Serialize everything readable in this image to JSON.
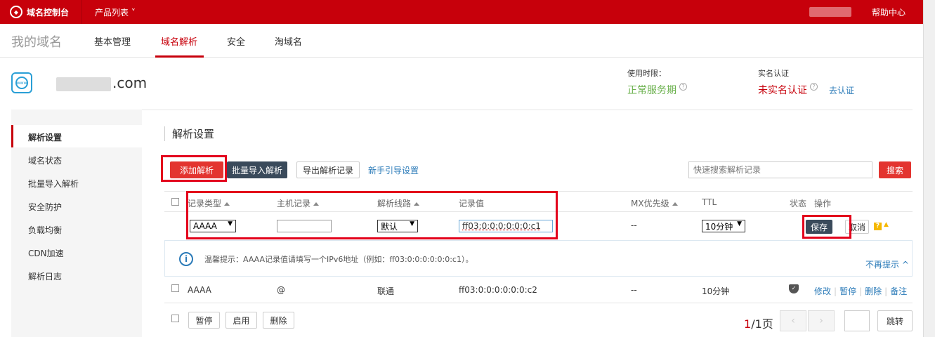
{
  "topbar": {
    "console_label": "域名控制台",
    "products_label": "产品列表 ˅",
    "help_label": "帮助中心"
  },
  "subnav": {
    "brand": "我的域名",
    "tabs": [
      "基本管理",
      "域名解析",
      "安全",
      "淘域名"
    ],
    "active_tab": "域名解析"
  },
  "domain": {
    "name_suffix": ".com",
    "period_label": "使用时限：",
    "period_value": "正常服务期",
    "realname_label": "实名认证",
    "realname_value": "未实名认证",
    "verify_link": "去认证"
  },
  "sidebar": {
    "items": [
      "解析设置",
      "域名状态",
      "批量导入解析",
      "安全防护",
      "负载均衡",
      "CDN加速",
      "解析日志"
    ],
    "active": "解析设置"
  },
  "content": {
    "section_title": "解析设置",
    "toolbar": {
      "add_label": "添加解析",
      "batch_import_label": "批量导入解析",
      "export_label": "导出解析记录",
      "guide_link": "新手引导设置",
      "search_placeholder": "快速搜索解析记录",
      "search_button": "搜索"
    },
    "columns": [
      "记录类型",
      "主机记录",
      "解析线路",
      "记录值",
      "MX优先级",
      "TTL",
      "状态",
      "操作"
    ],
    "edit_row": {
      "type": "AAAA",
      "host": "",
      "line": "默认",
      "value": "ff03:0:0:0:0:0:0:c1",
      "mx": "--",
      "ttl": "10分钟",
      "save_label": "保存",
      "cancel_label": "取消"
    },
    "tip": {
      "text": "温馨提示：AAAA记录值请填写一个IPv6地址（例如：ff03:0:0:0:0:0:0:c1）。",
      "dismiss": "不再提示"
    },
    "records": [
      {
        "type": "AAAA",
        "host": "@",
        "line": "联通",
        "value": "ff03:0:0:0:0:0:0:c2",
        "mx": "--",
        "ttl": "10分钟",
        "actions": [
          "修改",
          "暂停",
          "删除",
          "备注"
        ]
      }
    ],
    "footer": {
      "pause_label": "暂停",
      "enable_label": "启用",
      "delete_label": "删除",
      "page_current": "1",
      "page_info": "/1页",
      "jump_label": "跳转"
    }
  }
}
